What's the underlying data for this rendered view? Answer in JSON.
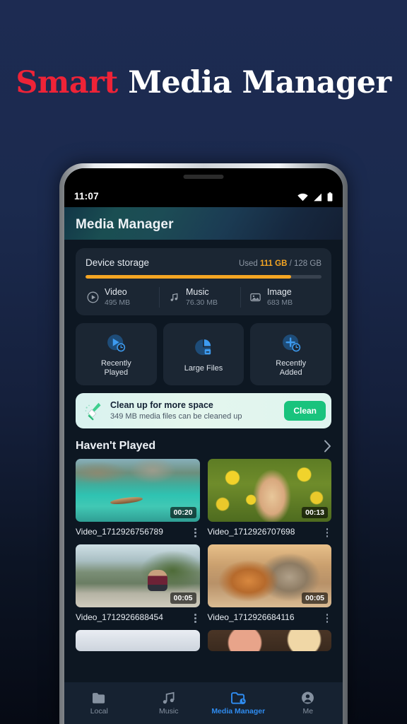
{
  "headline": {
    "accent_word": "Smart",
    "rest": " Media Manager",
    "accent_color": "#ee2337"
  },
  "status_bar": {
    "time": "11:07",
    "icons": [
      "wifi-icon",
      "signal-icon",
      "battery-icon"
    ]
  },
  "app": {
    "title": "Media Manager"
  },
  "storage": {
    "label": "Device storage",
    "used_prefix": "Used ",
    "used_value": "111 GB",
    "total_suffix": " / 128 GB",
    "percent": 87,
    "accent_color": "#f5a623",
    "categories": [
      {
        "icon": "video-play-icon",
        "name": "Video",
        "size": "495 MB"
      },
      {
        "icon": "music-note-icon",
        "name": "Music",
        "size": "76.30 MB"
      },
      {
        "icon": "image-icon",
        "name": "Image",
        "size": "683 MB"
      }
    ]
  },
  "tiles": [
    {
      "icon": "play-clock-icon",
      "label": "Recently\nPlayed"
    },
    {
      "icon": "pie-chart-icon",
      "label": "Large Files"
    },
    {
      "icon": "plus-clock-icon",
      "label": "Recently\nAdded"
    }
  ],
  "clean_banner": {
    "icon": "broom-icon",
    "title": "Clean up for more space",
    "subtitle": "349 MB media files can be cleaned up",
    "button_label": "Clean",
    "button_color": "#19c37d"
  },
  "section": {
    "title": "Haven't Played",
    "chevron": "chevron-right-icon"
  },
  "videos": [
    {
      "name": "Video_1712926756789",
      "duration": "00:20",
      "thumb": "ph-lake",
      "menu": "more-options-icon"
    },
    {
      "name": "Video_1712926707698",
      "duration": "00:13",
      "thumb": "ph-flower",
      "menu": "more-options-icon"
    },
    {
      "name": "Video_1712926688454",
      "duration": "00:05",
      "thumb": "ph-cliff",
      "menu": "more-options-icon"
    },
    {
      "name": "Video_1712926684116",
      "duration": "00:05",
      "thumb": "ph-dogs",
      "menu": "more-options-icon"
    }
  ],
  "bottom_nav": {
    "active_color": "#2f8cf0",
    "items": [
      {
        "icon": "folder-icon",
        "label": "Local",
        "active": false
      },
      {
        "icon": "music-note-icon",
        "label": "Music",
        "active": false
      },
      {
        "icon": "media-manager-icon",
        "label": "Media Manager",
        "active": true
      },
      {
        "icon": "person-icon",
        "label": "Me",
        "active": false
      }
    ]
  }
}
